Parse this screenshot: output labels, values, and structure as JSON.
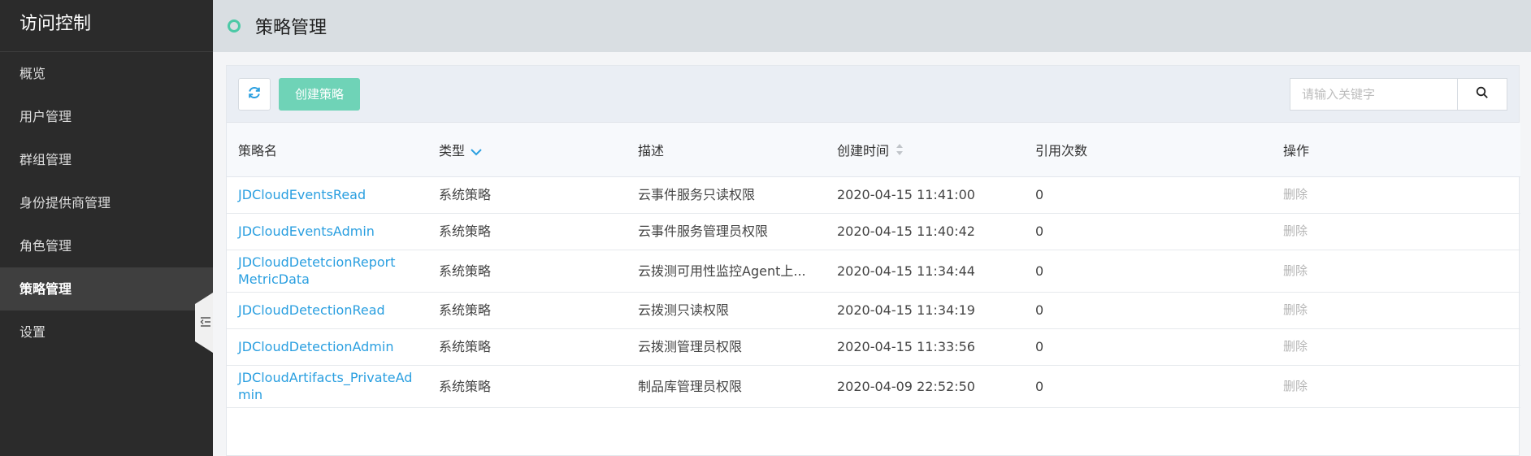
{
  "sidebar": {
    "title": "访问控制",
    "items": [
      {
        "label": "概览"
      },
      {
        "label": "用户管理"
      },
      {
        "label": "群组管理"
      },
      {
        "label": "身份提供商管理"
      },
      {
        "label": "角色管理"
      },
      {
        "label": "策略管理",
        "active": true
      },
      {
        "label": "设置"
      }
    ]
  },
  "header": {
    "title": "策略管理"
  },
  "toolbar": {
    "create_label": "创建策略",
    "search_placeholder": "请输入关键字"
  },
  "table": {
    "columns": [
      "策略名",
      "类型",
      "描述",
      "创建时间",
      "引用次数",
      "操作"
    ],
    "rows": [
      {
        "name": "JDCloudEventsRead",
        "type": "系统策略",
        "desc": "云事件服务只读权限",
        "created": "2020-04-15 11:41:00",
        "refs": "0",
        "action": "删除"
      },
      {
        "name": "JDCloudEventsAdmin",
        "type": "系统策略",
        "desc": "云事件服务管理员权限",
        "created": "2020-04-15 11:40:42",
        "refs": "0",
        "action": "删除"
      },
      {
        "name": "JDCloudDetetcionReport MetricData",
        "type": "系统策略",
        "desc": "云拨测可用性监控Agent上...",
        "created": "2020-04-15 11:34:44",
        "refs": "0",
        "action": "删除"
      },
      {
        "name": "JDCloudDetectionRead",
        "type": "系统策略",
        "desc": "云拨测只读权限",
        "created": "2020-04-15 11:34:19",
        "refs": "0",
        "action": "删除"
      },
      {
        "name": "JDCloudDetectionAdmin",
        "type": "系统策略",
        "desc": "云拨测管理员权限",
        "created": "2020-04-15 11:33:56",
        "refs": "0",
        "action": "删除"
      },
      {
        "name": "JDCloudArtifacts_PrivateAdmin",
        "type": "系统策略",
        "desc": "制品库管理员权限",
        "created": "2020-04-09 22:52:50",
        "refs": "0",
        "action": "删除"
      }
    ]
  },
  "colors": {
    "accent": "#2a9fe0",
    "primary_button": "#6fd3b7",
    "header_dot": "#4cc9a6",
    "sidebar_bg": "#2b2b2b"
  }
}
